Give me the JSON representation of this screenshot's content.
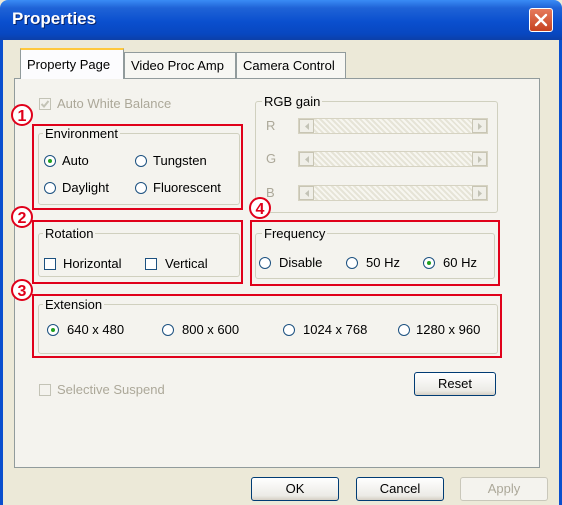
{
  "window": {
    "title": "Properties",
    "close": "close"
  },
  "tabs": [
    {
      "label": "Property Page",
      "active": true
    },
    {
      "label": "Video Proc Amp",
      "active": false
    },
    {
      "label": "Camera Control",
      "active": false
    }
  ],
  "badges": [
    "1",
    "2",
    "3",
    "4"
  ],
  "auto_white_balance": {
    "label": "Auto White Balance",
    "checked": true,
    "enabled": false
  },
  "environment": {
    "legend": "Environment",
    "options": [
      {
        "label": "Auto",
        "selected": true
      },
      {
        "label": "Tungsten",
        "selected": false
      },
      {
        "label": "Daylight",
        "selected": false
      },
      {
        "label": "Fluorescent",
        "selected": false
      }
    ]
  },
  "rgb_gain": {
    "legend": "RGB gain",
    "channels": [
      "R",
      "G",
      "B"
    ]
  },
  "rotation": {
    "legend": "Rotation",
    "horizontal": {
      "label": "Horizontal",
      "checked": false
    },
    "vertical": {
      "label": "Vertical",
      "checked": false
    }
  },
  "frequency": {
    "legend": "Frequency",
    "options": [
      {
        "label": "Disable",
        "selected": false
      },
      {
        "label": "50 Hz",
        "selected": false
      },
      {
        "label": "60 Hz",
        "selected": true
      }
    ]
  },
  "extension": {
    "legend": "Extension",
    "options": [
      {
        "label": "640 x 480",
        "selected": true
      },
      {
        "label": "800 x 600",
        "selected": false
      },
      {
        "label": "1024 x 768",
        "selected": false
      },
      {
        "label": "1280 x 960",
        "selected": false
      }
    ]
  },
  "selective_suspend": {
    "label": "Selective Suspend",
    "checked": false,
    "enabled": false
  },
  "buttons": {
    "reset": "Reset",
    "ok": "OK",
    "cancel": "Cancel",
    "apply": "Apply"
  },
  "colors": {
    "title_bar": "#0a4fce",
    "annotation_red": "#e0001a",
    "radio_dot": "#21a121"
  }
}
